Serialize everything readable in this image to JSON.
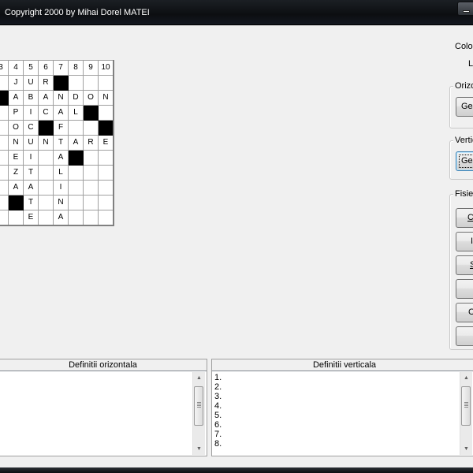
{
  "window": {
    "title": "Copyright 2000 by Mihai Dorel MATEI"
  },
  "grid": {
    "headers": [
      "3",
      "4",
      "5",
      "6",
      "7",
      "8",
      "9",
      "10"
    ],
    "rows": [
      [
        "",
        "J",
        "U",
        "R",
        "#",
        "",
        "",
        ""
      ],
      [
        "#",
        "A",
        "B",
        "A",
        "N",
        "D",
        "O",
        "N"
      ],
      [
        "",
        "P",
        "I",
        "C",
        "A",
        "L",
        "#",
        ""
      ],
      [
        "",
        "O",
        "C",
        "#",
        "F",
        "",
        "",
        "#"
      ],
      [
        "",
        "N",
        "U",
        "N",
        "T",
        "A",
        "R",
        "E"
      ],
      [
        "",
        "E",
        "I",
        "",
        "A",
        "#",
        "",
        ""
      ],
      [
        "",
        "Z",
        "T",
        "",
        "L",
        "",
        "",
        ""
      ],
      [
        "",
        "A",
        "A",
        "",
        "I",
        "",
        "",
        ""
      ],
      [
        "",
        "#",
        "T",
        "",
        "N",
        "",
        "",
        ""
      ],
      [
        "",
        "",
        "E",
        "",
        "A",
        "",
        "",
        ""
      ]
    ]
  },
  "right_panel": {
    "label_coloane": "Coloa",
    "label_linii": "L",
    "orizontal_group": "Orizo",
    "orizontal_button": "Gen",
    "vertical_group": "Vertic",
    "vertical_button": "Gen",
    "fisier_group": "Fisier",
    "fisier_buttons": [
      "Co",
      "I",
      "S",
      "",
      "C",
      ""
    ]
  },
  "definitions": {
    "horizontal_title": "Definitii orizontala",
    "vertical_title": "Definitii verticala",
    "vertical_lines": [
      "1.",
      "2.",
      "3.",
      "4.",
      "5.",
      "6.",
      "7.",
      "8."
    ]
  },
  "icons": {
    "minimize": "minimize-icon",
    "scroll_up": "scroll-up-arrow-icon",
    "scroll_down": "scroll-down-arrow-icon"
  }
}
